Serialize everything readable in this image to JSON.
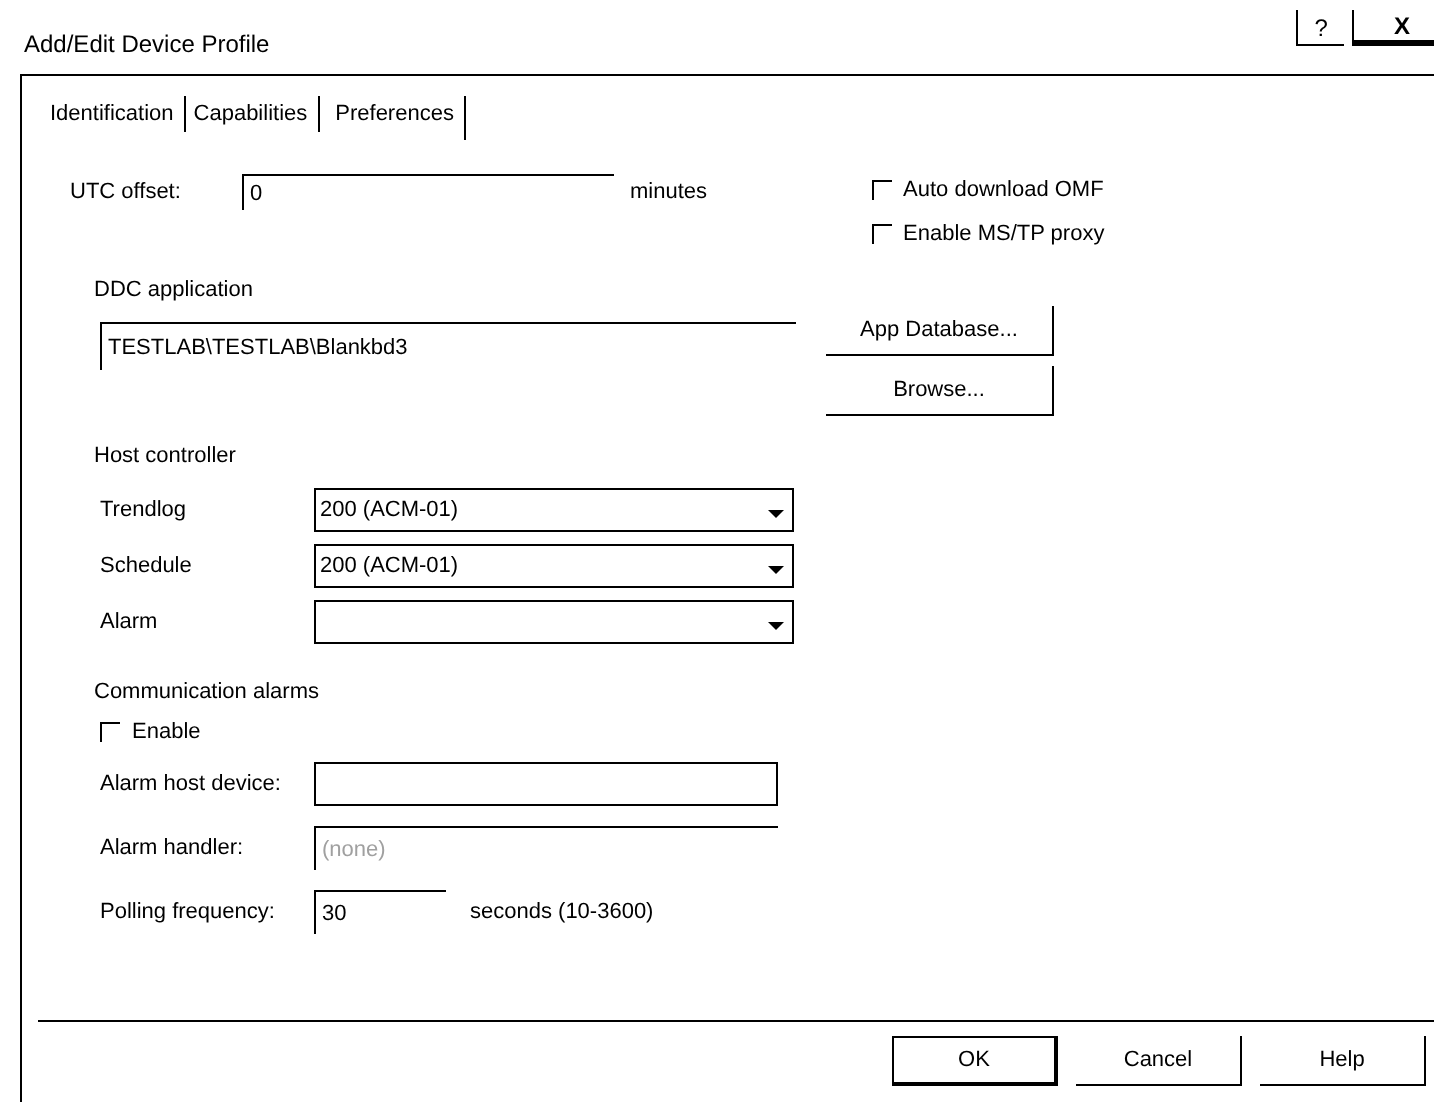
{
  "window": {
    "title": "Add/Edit Device Profile",
    "help_button": "?",
    "close_button": "X"
  },
  "tabs": [
    {
      "label": "Identification",
      "selected": false
    },
    {
      "label": "Capabilities",
      "selected": false
    },
    {
      "label": "Preferences",
      "selected": true
    }
  ],
  "utc_offset": {
    "label": "UTC offset:",
    "value": "0",
    "unit": "minutes"
  },
  "options": [
    {
      "label": "Auto download OMF",
      "checked": false
    },
    {
      "label": "Enable MS/TP proxy",
      "checked": false
    }
  ],
  "ddc_application": {
    "heading": "DDC application",
    "value": "TESTLAB\\TESTLAB\\Blankbd3",
    "buttons": [
      "App Database...",
      "Browse..."
    ]
  },
  "host_controller": {
    "heading": "Host controller",
    "fields": [
      {
        "label": "Trendlog",
        "value": "200 (ACM-01)"
      },
      {
        "label": "Schedule",
        "value": "200 (ACM-01)"
      },
      {
        "label": "Alarm"
      }
    ]
  },
  "communication_alarms": {
    "heading": "Communication alarms",
    "enable": {
      "label": "Enable",
      "checked": false
    },
    "alarm_host_device": {
      "label": "Alarm host device:"
    },
    "alarm_handler": {
      "label": "Alarm handler:",
      "value": "(none)",
      "disabled": true
    },
    "polling_frequency": {
      "label": "Polling frequency:",
      "value": "30",
      "hint": "seconds (10-3600)"
    }
  },
  "buttons": [
    {
      "label": "OK",
      "default": true
    },
    {
      "label": "Cancel",
      "default": false
    },
    {
      "label": "Help",
      "default": false
    }
  ]
}
